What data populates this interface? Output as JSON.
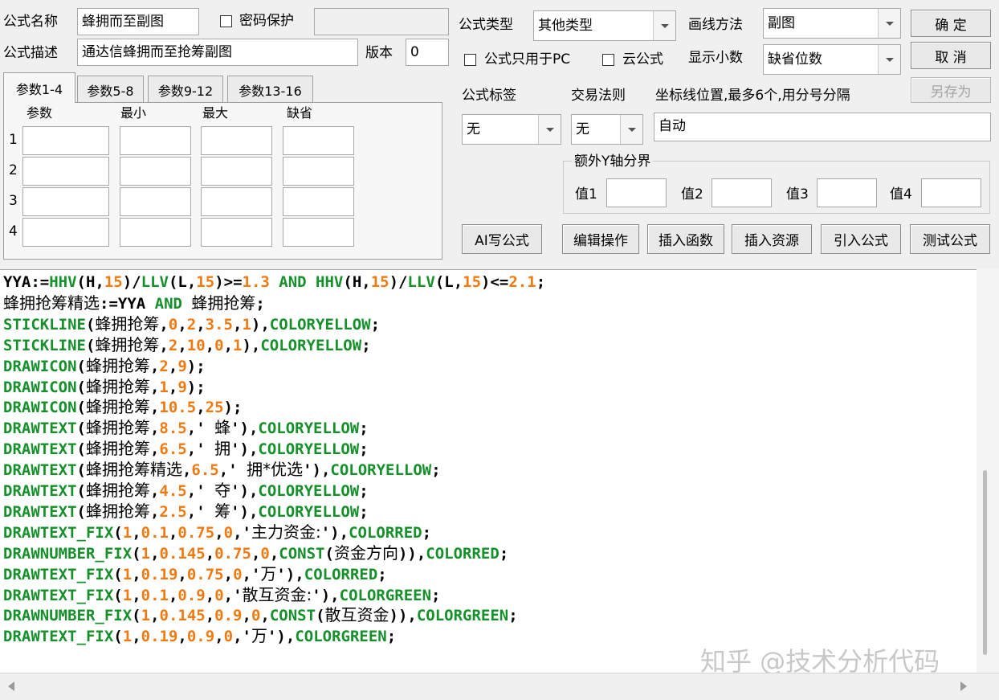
{
  "labels": {
    "name": "公式名称",
    "desc": "公式描述",
    "version": "版本",
    "pwd": "密码保护",
    "type": "公式类型",
    "draw": "画线方法",
    "pc_only": "公式只用于PC",
    "cloud": "云公式",
    "decimals": "显示小数",
    "tag": "公式标签",
    "trade": "交易法则",
    "coord": "坐标线位置,最多6个,用分号分隔",
    "yaxis": "额外Y轴分界"
  },
  "fields": {
    "name": "蜂拥而至副图",
    "desc": "通达信蜂拥而至抢筹副图",
    "version": "0",
    "password": "",
    "type": "其他类型",
    "draw": "副图",
    "decimals": "缺省位数",
    "tag": "无",
    "trade": "无",
    "coord": "自动",
    "v1_label": "值1",
    "v2_label": "值2",
    "v3_label": "值3",
    "v4_label": "值4"
  },
  "buttons": {
    "ok": "确 定",
    "cancel": "取 消",
    "saveas": "另存为",
    "ai": "AI写公式",
    "edit": "编辑操作",
    "insfunc": "插入函数",
    "insres": "插入资源",
    "import": "引入公式",
    "test": "测试公式"
  },
  "tabs": [
    "参数1-4",
    "参数5-8",
    "参数9-12",
    "参数13-16"
  ],
  "param_headers": [
    "参数",
    "最小",
    "最大",
    "缺省"
  ],
  "param_rows": [
    "1",
    "2",
    "3",
    "4"
  ],
  "code_lines": [
    [
      [
        "k",
        "YYA:="
      ],
      [
        "g",
        "HHV"
      ],
      [
        "k",
        "(H,"
      ],
      [
        "o",
        "15"
      ],
      [
        "k",
        ")/"
      ],
      [
        "g",
        "LLV"
      ],
      [
        "k",
        "(L,"
      ],
      [
        "o",
        "15"
      ],
      [
        "k",
        ")>="
      ],
      [
        "o",
        "1.3"
      ],
      [
        "g",
        " AND "
      ],
      [
        "g",
        "HHV"
      ],
      [
        "k",
        "(H,"
      ],
      [
        "o",
        "15"
      ],
      [
        "k",
        ")/"
      ],
      [
        "g",
        "LLV"
      ],
      [
        "k",
        "(L,"
      ],
      [
        "o",
        "15"
      ],
      [
        "k",
        ")<="
      ],
      [
        "o",
        "2.1"
      ],
      [
        "k",
        ";"
      ]
    ],
    [
      [
        "h",
        "蜂拥抢筹精选"
      ],
      [
        "k",
        ":=YYA"
      ],
      [
        "g",
        " AND "
      ],
      [
        "h",
        "蜂拥抢筹"
      ],
      [
        "k",
        ";"
      ]
    ],
    [
      [
        "g",
        "STICKLINE"
      ],
      [
        "k",
        "("
      ],
      [
        "h",
        "蜂拥抢筹"
      ],
      [
        "k",
        ","
      ],
      [
        "o",
        "0"
      ],
      [
        "k",
        ","
      ],
      [
        "o",
        "2"
      ],
      [
        "k",
        ","
      ],
      [
        "o",
        "3.5"
      ],
      [
        "k",
        ","
      ],
      [
        "o",
        "1"
      ],
      [
        "k",
        "),"
      ],
      [
        "g",
        "COLORYELLOW"
      ],
      [
        "k",
        ";"
      ]
    ],
    [
      [
        "g",
        "STICKLINE"
      ],
      [
        "k",
        "("
      ],
      [
        "h",
        "蜂拥抢筹"
      ],
      [
        "k",
        ","
      ],
      [
        "o",
        "2"
      ],
      [
        "k",
        ","
      ],
      [
        "o",
        "10"
      ],
      [
        "k",
        ","
      ],
      [
        "o",
        "0"
      ],
      [
        "k",
        ","
      ],
      [
        "o",
        "1"
      ],
      [
        "k",
        "),"
      ],
      [
        "g",
        "COLORYELLOW"
      ],
      [
        "k",
        ";"
      ]
    ],
    [
      [
        "g",
        "DRAWICON"
      ],
      [
        "k",
        "("
      ],
      [
        "h",
        "蜂拥抢筹"
      ],
      [
        "k",
        ","
      ],
      [
        "o",
        "2"
      ],
      [
        "k",
        ","
      ],
      [
        "o",
        "9"
      ],
      [
        "k",
        ");"
      ]
    ],
    [
      [
        "g",
        "DRAWICON"
      ],
      [
        "k",
        "("
      ],
      [
        "h",
        "蜂拥抢筹"
      ],
      [
        "k",
        ","
      ],
      [
        "o",
        "1"
      ],
      [
        "k",
        ","
      ],
      [
        "o",
        "9"
      ],
      [
        "k",
        ");"
      ]
    ],
    [
      [
        "g",
        "DRAWICON"
      ],
      [
        "k",
        "("
      ],
      [
        "h",
        "蜂拥抢筹"
      ],
      [
        "k",
        ","
      ],
      [
        "o",
        "10.5"
      ],
      [
        "k",
        ","
      ],
      [
        "o",
        "25"
      ],
      [
        "k",
        ");"
      ]
    ],
    [
      [
        "g",
        "DRAWTEXT"
      ],
      [
        "k",
        "("
      ],
      [
        "h",
        "蜂拥抢筹"
      ],
      [
        "k",
        ","
      ],
      [
        "o",
        "8.5"
      ],
      [
        "k",
        ",' "
      ],
      [
        "h",
        "蜂"
      ],
      [
        "k",
        "'),"
      ],
      [
        "g",
        "COLORYELLOW"
      ],
      [
        "k",
        ";"
      ]
    ],
    [
      [
        "g",
        "DRAWTEXT"
      ],
      [
        "k",
        "("
      ],
      [
        "h",
        "蜂拥抢筹"
      ],
      [
        "k",
        ","
      ],
      [
        "o",
        "6.5"
      ],
      [
        "k",
        ",' "
      ],
      [
        "h",
        "拥"
      ],
      [
        "k",
        "'),"
      ],
      [
        "g",
        "COLORYELLOW"
      ],
      [
        "k",
        ";"
      ]
    ],
    [
      [
        "g",
        "DRAWTEXT"
      ],
      [
        "k",
        "("
      ],
      [
        "h",
        "蜂拥抢筹精选"
      ],
      [
        "k",
        ","
      ],
      [
        "o",
        "6.5"
      ],
      [
        "k",
        ",' "
      ],
      [
        "h",
        "拥*优选"
      ],
      [
        "k",
        "'),"
      ],
      [
        "g",
        "COLORYELLOW"
      ],
      [
        "k",
        ";"
      ]
    ],
    [
      [
        "g",
        "DRAWTEXT"
      ],
      [
        "k",
        "("
      ],
      [
        "h",
        "蜂拥抢筹"
      ],
      [
        "k",
        ","
      ],
      [
        "o",
        "4.5"
      ],
      [
        "k",
        ",' "
      ],
      [
        "h",
        "夺"
      ],
      [
        "k",
        "'),"
      ],
      [
        "g",
        "COLORYELLOW"
      ],
      [
        "k",
        ";"
      ]
    ],
    [
      [
        "g",
        "DRAWTEXT"
      ],
      [
        "k",
        "("
      ],
      [
        "h",
        "蜂拥抢筹"
      ],
      [
        "k",
        ","
      ],
      [
        "o",
        "2.5"
      ],
      [
        "k",
        ",' "
      ],
      [
        "h",
        "筹"
      ],
      [
        "k",
        "'),"
      ],
      [
        "g",
        "COLORYELLOW"
      ],
      [
        "k",
        ";"
      ]
    ],
    [
      [
        "g",
        "DRAWTEXT_FIX"
      ],
      [
        "k",
        "("
      ],
      [
        "o",
        "1"
      ],
      [
        "k",
        ","
      ],
      [
        "o",
        "0.1"
      ],
      [
        "k",
        ","
      ],
      [
        "o",
        "0.75"
      ],
      [
        "k",
        ","
      ],
      [
        "o",
        "0"
      ],
      [
        "k",
        ",'"
      ],
      [
        "h",
        "主力资金:"
      ],
      [
        "k",
        "'),"
      ],
      [
        "g",
        "COLORRED"
      ],
      [
        "k",
        ";"
      ]
    ],
    [
      [
        "g",
        "DRAWNUMBER_FIX"
      ],
      [
        "k",
        "("
      ],
      [
        "o",
        "1"
      ],
      [
        "k",
        ","
      ],
      [
        "o",
        "0.145"
      ],
      [
        "k",
        ","
      ],
      [
        "o",
        "0.75"
      ],
      [
        "k",
        ","
      ],
      [
        "o",
        "0"
      ],
      [
        "k",
        ","
      ],
      [
        "g",
        "CONST"
      ],
      [
        "k",
        "("
      ],
      [
        "h",
        "资金方向"
      ],
      [
        "k",
        "))"
      ],
      [
        "k",
        ","
      ],
      [
        "g",
        "COLORRED"
      ],
      [
        "k",
        ";"
      ]
    ],
    [
      [
        "g",
        "DRAWTEXT_FIX"
      ],
      [
        "k",
        "("
      ],
      [
        "o",
        "1"
      ],
      [
        "k",
        ","
      ],
      [
        "o",
        "0.19"
      ],
      [
        "k",
        ","
      ],
      [
        "o",
        "0.75"
      ],
      [
        "k",
        ","
      ],
      [
        "o",
        "0"
      ],
      [
        "k",
        ",'"
      ],
      [
        "h",
        "万"
      ],
      [
        "k",
        "'),"
      ],
      [
        "g",
        "COLORRED"
      ],
      [
        "k",
        ";"
      ]
    ],
    [
      [
        "g",
        "DRAWTEXT_FIX"
      ],
      [
        "k",
        "("
      ],
      [
        "o",
        "1"
      ],
      [
        "k",
        ","
      ],
      [
        "o",
        "0.1"
      ],
      [
        "k",
        ","
      ],
      [
        "o",
        "0.9"
      ],
      [
        "k",
        ","
      ],
      [
        "o",
        "0"
      ],
      [
        "k",
        ",'"
      ],
      [
        "h",
        "散互资金:"
      ],
      [
        "k",
        "'),"
      ],
      [
        "g",
        "COLORGREEN"
      ],
      [
        "k",
        ";"
      ]
    ],
    [
      [
        "g",
        "DRAWNUMBER_FIX"
      ],
      [
        "k",
        "("
      ],
      [
        "o",
        "1"
      ],
      [
        "k",
        ","
      ],
      [
        "o",
        "0.145"
      ],
      [
        "k",
        ","
      ],
      [
        "o",
        "0.9"
      ],
      [
        "k",
        ","
      ],
      [
        "o",
        "0"
      ],
      [
        "k",
        ","
      ],
      [
        "g",
        "CONST"
      ],
      [
        "k",
        "("
      ],
      [
        "h",
        "散互资金"
      ],
      [
        "k",
        "))"
      ],
      [
        "k",
        ","
      ],
      [
        "g",
        "COLORGREEN"
      ],
      [
        "k",
        ";"
      ]
    ],
    [
      [
        "g",
        "DRAWTEXT_FIX"
      ],
      [
        "k",
        "("
      ],
      [
        "o",
        "1"
      ],
      [
        "k",
        ","
      ],
      [
        "o",
        "0.19"
      ],
      [
        "k",
        ","
      ],
      [
        "o",
        "0.9"
      ],
      [
        "k",
        ","
      ],
      [
        "o",
        "0"
      ],
      [
        "k",
        ",'"
      ],
      [
        "h",
        "万"
      ],
      [
        "k",
        "'),"
      ],
      [
        "g",
        "COLORGREEN"
      ],
      [
        "k",
        ";"
      ]
    ]
  ],
  "watermark": "知乎 @技术分析代码",
  "colors": {
    "keyword": "#15902a",
    "number": "#f07a10"
  }
}
